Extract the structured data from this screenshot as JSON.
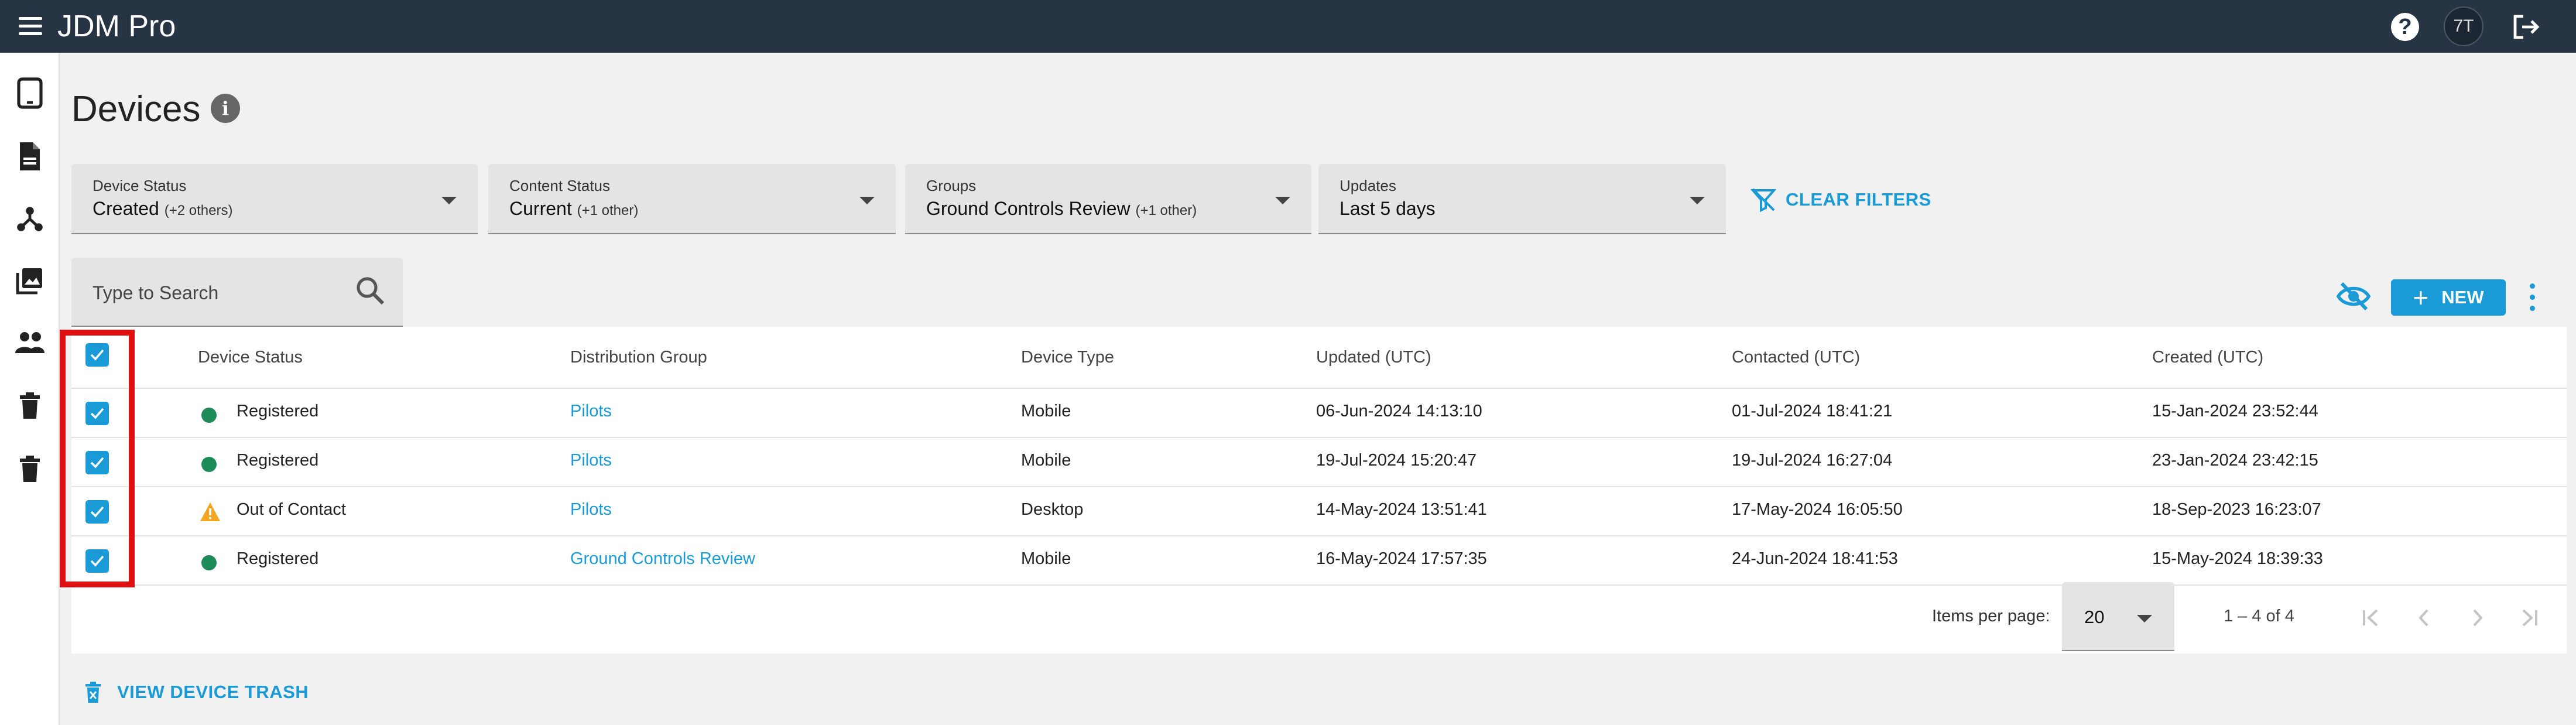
{
  "app": {
    "title": "JDM Pro",
    "user_initials": "7T",
    "help_label": "?"
  },
  "page": {
    "title": "Devices"
  },
  "filters": [
    {
      "label": "Device Status",
      "value": "Created",
      "extra": "(+2 others)"
    },
    {
      "label": "Content Status",
      "value": "Current",
      "extra": "(+1 other)"
    },
    {
      "label": "Groups",
      "value": "Ground Controls Review",
      "extra": "(+1 other)"
    },
    {
      "label": "Updates",
      "value": "Last 5 days",
      "extra": ""
    }
  ],
  "clear_filters_label": "CLEAR FILTERS",
  "search": {
    "placeholder": "Type to Search"
  },
  "toolbar": {
    "new_label": "NEW"
  },
  "table": {
    "columns": [
      "Device Status",
      "Distribution Group",
      "Device Type",
      "Updated (UTC)",
      "Contacted (UTC)",
      "Created (UTC)"
    ],
    "rows": [
      {
        "status": "Registered",
        "status_icon": "green-dot-icon",
        "group": "Pilots",
        "type": "Mobile",
        "updated": "06-Jun-2024 14:13:10",
        "contacted": "01-Jul-2024 18:41:21",
        "created": "15-Jan-2024 23:52:44",
        "checked": true
      },
      {
        "status": "Registered",
        "status_icon": "green-dot-icon",
        "group": "Pilots",
        "type": "Mobile",
        "updated": "19-Jul-2024 15:20:47",
        "contacted": "19-Jul-2024 16:27:04",
        "created": "23-Jan-2024 23:42:15",
        "checked": true
      },
      {
        "status": "Out of Contact",
        "status_icon": "warning-icon",
        "group": "Pilots",
        "type": "Desktop",
        "updated": "14-May-2024 13:51:41",
        "contacted": "17-May-2024 16:05:50",
        "created": "18-Sep-2023 16:23:07",
        "checked": true
      },
      {
        "status": "Registered",
        "status_icon": "green-dot-icon",
        "group": "Ground Controls Review",
        "type": "Mobile",
        "updated": "16-May-2024 17:57:35",
        "contacted": "24-Jun-2024 18:41:53",
        "created": "15-May-2024 18:39:33",
        "checked": true
      }
    ]
  },
  "paginator": {
    "items_per_page_label": "Items per page:",
    "items_per_page": "20",
    "range": "1 – 4 of 4"
  },
  "trash_link_label": "VIEW DEVICE TRASH",
  "colors": {
    "topbar": "#263444",
    "accent": "#1a9ad6",
    "registered": "#1d8a5a",
    "warning": "#f5a623",
    "highlight": "#e01010"
  },
  "sidebar_icons": [
    "tablet-icon",
    "document-icon",
    "hierarchy-icon",
    "image-library-icon",
    "people-icon",
    "trash-icon",
    "trash-icon"
  ]
}
